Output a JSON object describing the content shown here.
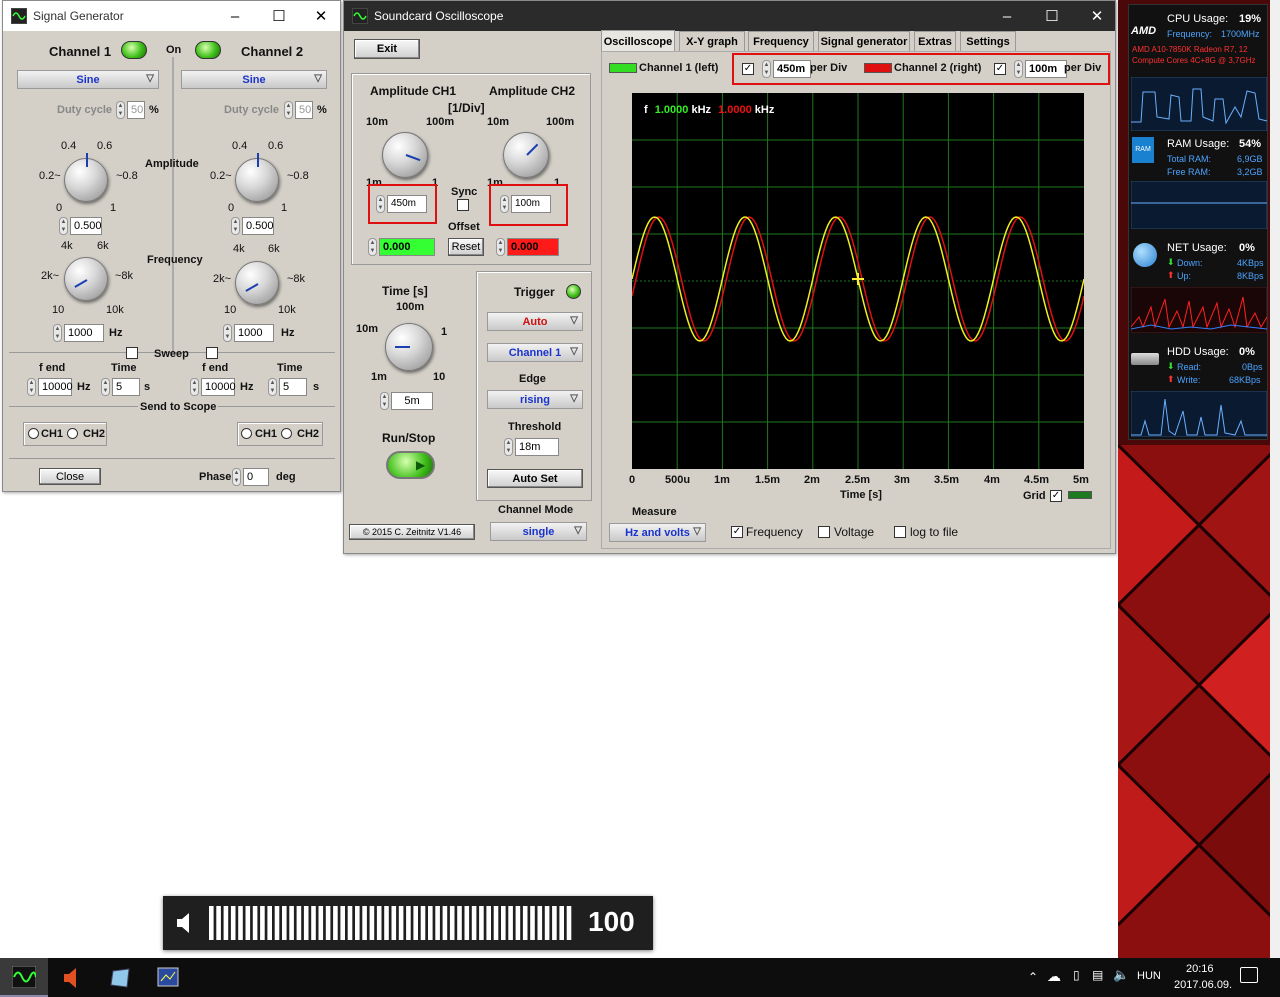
{
  "siggen": {
    "title": "Signal Generator",
    "ch1_title": "Channel 1",
    "ch2_title": "Channel 2",
    "on_label": "On",
    "ch1_wave": "Sine",
    "ch2_wave": "Sine",
    "duty_label": "Duty cycle",
    "duty_ch1": "50",
    "duty_ch2": "50",
    "percent": "%",
    "amplitude_label": "Amplitude",
    "amp_ticks": [
      "0.4",
      "0.6",
      "0.2~",
      "~0.8",
      "0",
      "1"
    ],
    "amp_ch1": "0.500",
    "amp_ch2": "0.500",
    "frequency_label": "Frequency",
    "freq_ticks": [
      "4k",
      "6k",
      "2k~",
      "~8k",
      "10",
      "10k"
    ],
    "freq_ch1": "1000",
    "freq_ch2": "1000",
    "hz": "Hz",
    "sweep_label": "Sweep",
    "fend_label": "f end",
    "time_label": "Time",
    "fend_ch1": "10000",
    "fend_ch2": "10000",
    "time_ch1": "5",
    "time_ch2": "5",
    "s": "s",
    "send_label": "Send to Scope",
    "ch1": "CH1",
    "ch2": "CH2",
    "close": "Close",
    "phase_label": "Phase",
    "phase_val": "0",
    "deg": "deg"
  },
  "scope": {
    "title": "Soundcard Oscilloscope",
    "exit": "Exit",
    "tabs": [
      "Oscilloscope",
      "X-Y graph",
      "Frequency",
      "Signal generator",
      "Extras",
      "Settings"
    ],
    "amp_ch1_label": "Amplitude CH1",
    "amp_ch2_label": "Amplitude CH2",
    "div_label": "[1/Div]",
    "amp_ticks": [
      "10m",
      "100m",
      "1m",
      "1"
    ],
    "amp_ch1_val": "450m",
    "amp_ch2_val": "100m",
    "sync_label": "Sync",
    "offset_label": "Offset",
    "reset": "Reset",
    "offset_ch1": "0.000",
    "offset_ch2": "0.000",
    "time_label": "Time [s]",
    "time_ticks": [
      "100m",
      "10m",
      "1",
      "1m",
      "10"
    ],
    "time_val": "5m",
    "trigger_label": "Trigger",
    "trigger_mode": "Auto",
    "trigger_channel": "Channel 1",
    "edge_label": "Edge",
    "edge_val": "rising",
    "threshold_label": "Threshold",
    "threshold_val": "18m",
    "autoset": "Auto Set",
    "runstop_label": "Run/Stop",
    "chmode_label": "Channel Mode",
    "chmode_val": "single",
    "copyright": "© 2015  C. Zeitnitz V1.46",
    "legend_ch1": "Channel 1 (left)",
    "legend_ch2": "Channel 2 (right)",
    "per_div_ch1": "450m",
    "per_div_ch2": "100m",
    "per_div_label": "per Div",
    "freq_label": "f",
    "freq_ch1": "1.0000",
    "freq_ch2": "1.0000",
    "khz": "kHz",
    "x_ticks": [
      "0",
      "500u",
      "1m",
      "1.5m",
      "2m",
      "2.5m",
      "3m",
      "3.5m",
      "4m",
      "4.5m",
      "5m"
    ],
    "x_axis_label": "Time [s]",
    "grid_label": "Grid",
    "measure_label": "Measure",
    "measure_val": "Hz and volts",
    "chk_frequency": "Frequency",
    "chk_voltage": "Voltage",
    "chk_log": "log to file",
    "colors": {
      "ch1": "#f0f020",
      "ch2": "#e01010",
      "legend_ch1": "#33dd22",
      "grid": "#1e7a1e"
    }
  },
  "sidebar": {
    "cpu_title": "CPU Usage:",
    "cpu_val": "19%",
    "cpu_freq_label": "Frequency:",
    "cpu_freq_val": "1700MHz",
    "cpu_model1": "AMD A10-7850K Radeon R7, 12",
    "cpu_model2": "Compute Cores 4C+8G @ 3,7GHz",
    "amd_logo": "AMD",
    "ram_title": "RAM Usage:",
    "ram_val": "54%",
    "ram_total_label": "Total RAM:",
    "ram_total_val": "6,9GB",
    "ram_free_label": "Free RAM:",
    "ram_free_val": "3,2GB",
    "net_title": "NET Usage:",
    "net_val": "0%",
    "net_down_label": "Down:",
    "net_down_val": "4KBps",
    "net_up_label": "Up:",
    "net_up_val": "8KBps",
    "hdd_title": "HDD Usage:",
    "hdd_val": "0%",
    "hdd_read_label": "Read:",
    "hdd_read_val": "0Bps",
    "hdd_write_label": "Write:",
    "hdd_write_val": "68KBps"
  },
  "volume": {
    "level": "100"
  },
  "taskbar": {
    "lang": "HUN",
    "time": "20:16",
    "date": "2017.06.09."
  }
}
